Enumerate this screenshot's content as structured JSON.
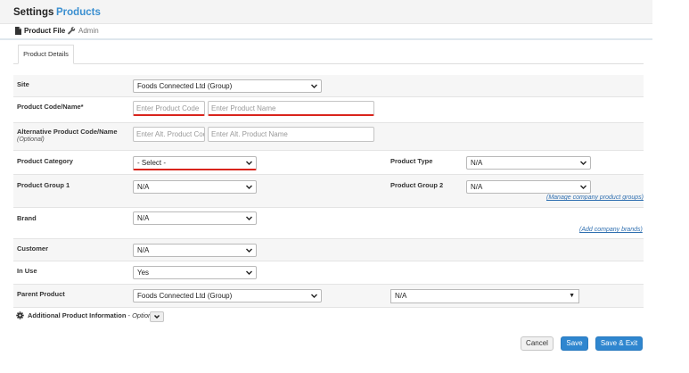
{
  "header": {
    "title": "Settings",
    "breadcrumb": "Products"
  },
  "subnav": {
    "items": [
      {
        "label": "Product File",
        "icon": "file-icon",
        "active": true
      },
      {
        "label": "Admin",
        "icon": "wrench-icon",
        "active": false
      }
    ]
  },
  "tabs": [
    {
      "label": "Product Details",
      "active": true
    }
  ],
  "form": {
    "site": {
      "label": "Site",
      "value": "Foods Connected Ltd (Group)"
    },
    "product_code_name": {
      "label": "Product Code/Name*",
      "code_placeholder": "Enter Product Code",
      "name_placeholder": "Enter Product Name"
    },
    "alt_code_name": {
      "label": "Alternative Product Code/Name",
      "sublabel": "(Optional)",
      "code_placeholder": "Enter Alt. Product Code",
      "name_placeholder": "Enter Alt. Product Name"
    },
    "product_category": {
      "label": "Product Category",
      "value": "- Select -"
    },
    "product_type": {
      "label": "Product Type",
      "value": "N/A"
    },
    "product_group_1": {
      "label": "Product Group 1",
      "value": "N/A"
    },
    "product_group_2": {
      "label": "Product Group 2",
      "value": "N/A",
      "link": "(Manage company product groups)"
    },
    "brand": {
      "label": "Brand",
      "value": "N/A",
      "link": "(Add company brands)"
    },
    "customer": {
      "label": "Customer",
      "value": "N/A"
    },
    "in_use": {
      "label": "In Use",
      "value": "Yes"
    },
    "parent_product": {
      "label": "Parent Product",
      "site_value": "Foods Connected Ltd (Group)",
      "product_value": "N/A"
    }
  },
  "additional": {
    "label": "Additional Product Information",
    "separator": " - ",
    "optional": "Optional",
    "icon": "gear-icon"
  },
  "actions": {
    "cancel": "Cancel",
    "save": "Save",
    "save_exit": "Save & Exit"
  },
  "colors": {
    "accent": "#2f86cf",
    "required": "#d9241c",
    "link": "#2f6fb0"
  }
}
